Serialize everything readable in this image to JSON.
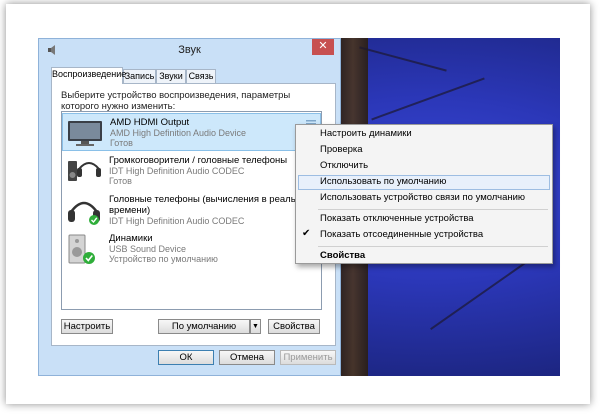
{
  "window": {
    "title": "Звук",
    "close_glyph": "✕"
  },
  "tabs": [
    {
      "label": "Воспроизведение",
      "active": true
    },
    {
      "label": "Запись",
      "active": false
    },
    {
      "label": "Звуки",
      "active": false
    },
    {
      "label": "Связь",
      "active": false
    }
  ],
  "instruction": "Выберите устройство воспроизведения, параметры которого нужно изменить:",
  "devices": [
    {
      "name": "AMD HDMI Output",
      "line1": "AMD High Definition Audio Device",
      "line2": "Готов",
      "icon": "monitor-icon",
      "selected": true
    },
    {
      "name": "Громкоговорители / головные телефоны",
      "line1": "IDT High Definition Audio CODEC",
      "line2": "Готов",
      "icon": "speakers-headphones-icon",
      "selected": false
    },
    {
      "name": "Головные телефоны (вычисления в реальном времени)",
      "line1": "IDT High Definition Audio CODEC",
      "line2": "",
      "icon": "headphones-icon",
      "selected": false
    },
    {
      "name": "Динамики",
      "line1": "USB Sound Device",
      "line2": "Устройство по умолчанию",
      "icon": "speaker-icon",
      "selected": false
    }
  ],
  "buttons": {
    "configure": "Настроить",
    "default": "По умолчанию",
    "properties": "Свойства",
    "ok": "ОК",
    "cancel": "Отмена",
    "apply": "Применить"
  },
  "context_menu": {
    "items": [
      {
        "label": "Настроить динамики",
        "highlighted": false,
        "checked": false,
        "bold": false
      },
      {
        "label": "Проверка",
        "highlighted": false,
        "checked": false,
        "bold": false
      },
      {
        "label": "Отключить",
        "highlighted": false,
        "checked": false,
        "bold": false
      },
      {
        "label": "Использовать по умолчанию",
        "highlighted": true,
        "checked": false,
        "bold": false
      },
      {
        "label": "Использовать устройство связи по умолчанию",
        "highlighted": false,
        "checked": false,
        "bold": false
      },
      {
        "label": "Показать отключенные устройства",
        "highlighted": false,
        "checked": false,
        "bold": false
      },
      {
        "label": "Показать отсоединенные устройства",
        "highlighted": false,
        "checked": true,
        "bold": false
      },
      {
        "label": "Свойства",
        "highlighted": false,
        "checked": false,
        "bold": true
      }
    ],
    "check_glyph": "✔"
  },
  "colors": {
    "selection": "#cde8fb",
    "close": "#c75050",
    "desktop": "#2b37b8",
    "default_badge": "#2fae3a"
  }
}
